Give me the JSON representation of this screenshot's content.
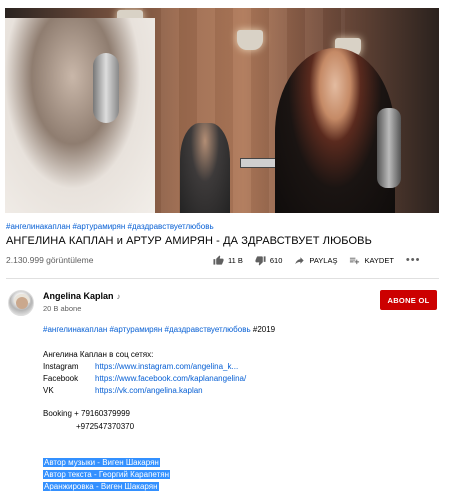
{
  "video": {
    "hashtags": "#ангелинакаплан #артурамирян #даздравствуетлюбовь",
    "title": "АНГЕЛИНА КАПЛАН и АРТУР АМИРЯН - ДА ЗДРАВСТВУЕТ ЛЮБОВЬ",
    "views": "2.130.999 görüntüleme"
  },
  "actions": {
    "likes": "11 B",
    "dislikes": "610",
    "share_label": "PAYLAŞ",
    "save_label": "KAYDET",
    "more_label": "•••"
  },
  "channel": {
    "name": "Angelina Kaplan",
    "note_icon": "♪",
    "subscribers": "20 B abone",
    "subscribe_label": "ABONE OL"
  },
  "description": {
    "tags": "#ангелинакаплан #артурамирян #даздравствуетлюбовь",
    "year": " #2019",
    "social_heading": "Ангелина Каплан в соц сетях:",
    "social": [
      {
        "label": "Instagram",
        "url": "https://www.instagram.com/angelina_k..."
      },
      {
        "label": "Facebook",
        "url": "https://www.facebook.com/kaplanangelina/"
      },
      {
        "label": "VK",
        "url": "https://vk.com/angelina.kaplan"
      }
    ],
    "booking1": "Booking + 79160379999",
    "booking2": "+972547370370",
    "credits": [
      "Автор музыки - Виген Шакарян",
      "Автор текста - Георгий Карапетян",
      "Аранжировка - Виген Шакарян"
    ]
  },
  "colors": {
    "link": "#065fd4",
    "subscribe": "#cc0000",
    "selection": "#3390ff"
  }
}
